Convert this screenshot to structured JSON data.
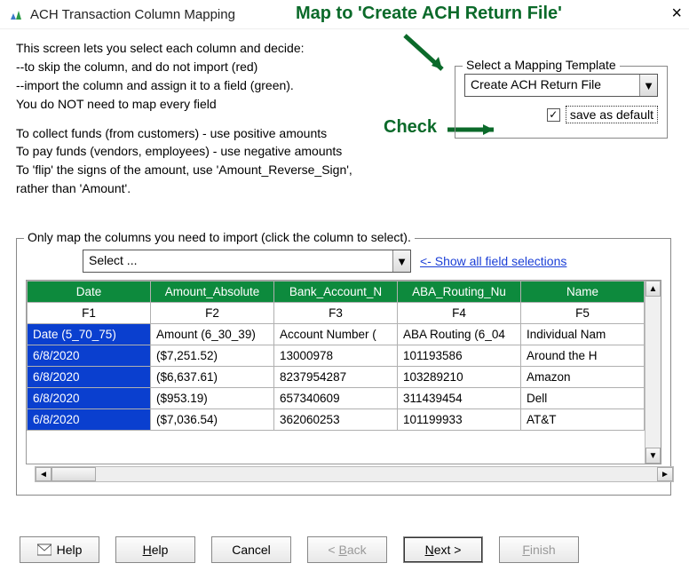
{
  "window": {
    "title": "ACH Transaction Column Mapping",
    "close": "×"
  },
  "annotations": {
    "map_to": "Map to 'Create ACH Return File'",
    "check": "Check"
  },
  "intro": {
    "l1": "This screen lets you select each column and decide:",
    "l2": "--to skip the column, and do not import (red)",
    "l3": "--import the column and assign it to a field (green).",
    "l4": "You do NOT need to map every field",
    "l5": "To collect funds (from customers) - use positive amounts",
    "l6": "To pay funds (vendors, employees) - use negative amounts",
    "l7": "To 'flip' the signs of the amount, use 'Amount_Reverse_Sign',",
    "l8": "rather than 'Amount'."
  },
  "template": {
    "legend": "Select a Mapping Template",
    "selected": "Create ACH Return File",
    "save_label": "save as default",
    "checked": "✓"
  },
  "columns": {
    "legend": "Only map the columns you need to import (click the column to select).",
    "select_placeholder": "Select ...",
    "show_all": "<-  Show all field selections",
    "headers": [
      "Date",
      "Amount_Absolute",
      "Bank_Account_N",
      "ABA_Routing_Nu",
      "Name"
    ],
    "subheaders": [
      "F1",
      "F2",
      "F3",
      "F4",
      "F5"
    ],
    "rows": [
      [
        "Date (5_70_75)",
        "Amount (6_30_39)",
        "Account Number (",
        "ABA Routing (6_04",
        "Individual Nam"
      ],
      [
        "6/8/2020",
        "($7,251.52)",
        "13000978",
        "101193586",
        "Around the H"
      ],
      [
        "6/8/2020",
        "($6,637.61)",
        "8237954287",
        "103289210",
        "Amazon"
      ],
      [
        "6/8/2020",
        "($953.19)",
        "657340609",
        "311439454",
        "Dell"
      ],
      [
        "6/8/2020",
        "($7,036.54)",
        "362060253",
        "101199933",
        "AT&T"
      ]
    ]
  },
  "buttons": {
    "help_icon": "Help",
    "help": "Help",
    "cancel": "Cancel",
    "back": "< Back",
    "next": "Next >",
    "finish": "Finish"
  }
}
